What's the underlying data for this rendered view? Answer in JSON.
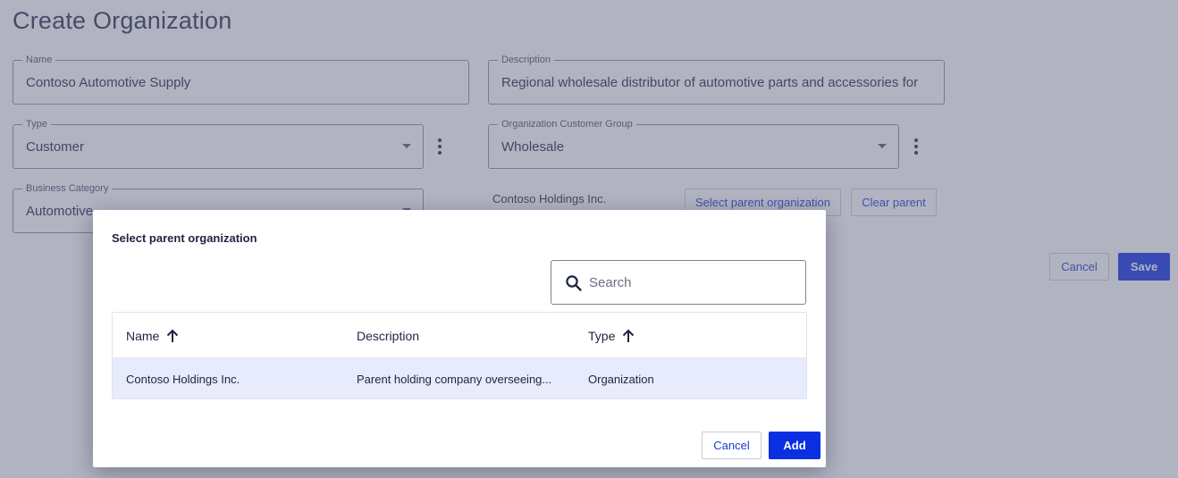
{
  "page": {
    "title": "Create Organization",
    "name": {
      "label": "Name",
      "value": "Contoso Automotive Supply"
    },
    "description": {
      "label": "Description",
      "value": "Regional wholesale distributor of automotive parts and accessories for"
    },
    "type": {
      "label": "Type",
      "value": "Customer"
    },
    "customer_group": {
      "label": "Organization Customer Group",
      "value": "Wholesale"
    },
    "business_category": {
      "label": "Business Category",
      "value": "Automotive"
    },
    "parent": {
      "name": "Contoso Holdings Inc.",
      "select_label": "Select parent organization",
      "clear_label": "Clear parent"
    },
    "cancel_label": "Cancel",
    "save_label": "Save"
  },
  "dialog": {
    "title": "Select parent organization",
    "search_placeholder": "Search",
    "columns": {
      "name": "Name",
      "description": "Description",
      "type": "Type"
    },
    "rows": [
      {
        "name": "Contoso Holdings Inc.",
        "description": "Parent holding company overseeing...",
        "type": "Organization"
      }
    ],
    "cancel_label": "Cancel",
    "add_label": "Add"
  },
  "colors": {
    "primary": "#0a2fe0",
    "link": "#1a3bd1",
    "selected_row": "#e8ebfb",
    "overlay": "#646784"
  },
  "icons": {
    "search": "search-icon",
    "sort": "arrow-up-icon",
    "menu": "more-vertical-icon",
    "dropdown": "caret-down-icon"
  }
}
